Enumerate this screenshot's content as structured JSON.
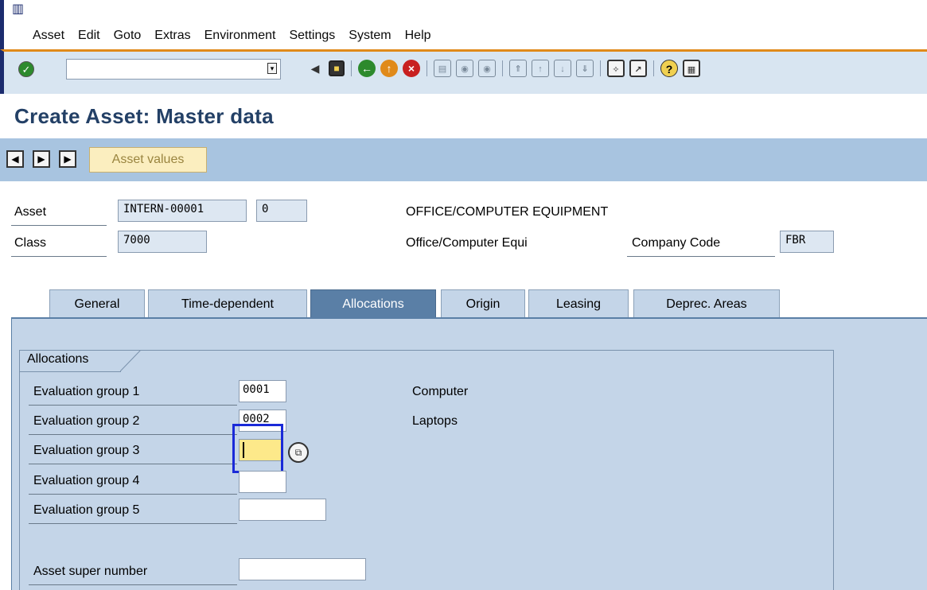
{
  "menubar": {
    "items": [
      {
        "label": "Asset"
      },
      {
        "label": "Edit"
      },
      {
        "label": "Goto"
      },
      {
        "label": "Extras"
      },
      {
        "label": "Environment"
      },
      {
        "label": "Settings"
      },
      {
        "label": "System"
      },
      {
        "label": "Help"
      }
    ]
  },
  "toolbar": {
    "command_value": "",
    "icons": [
      "enter-icon",
      "back-arrow-icon",
      "save-icon",
      "back-icon",
      "exit-icon",
      "cancel-icon",
      "print-icon",
      "find-icon",
      "find-next-icon",
      "first-page-icon",
      "previous-page-icon",
      "next-page-icon",
      "last-page-icon",
      "create-session-icon",
      "shortcut-icon",
      "help-icon",
      "layout-icon"
    ]
  },
  "page": {
    "title": "Create Asset: Master data"
  },
  "apptoolbar": {
    "asset_values_label": "Asset values"
  },
  "header": {
    "asset_label": "Asset",
    "asset_number": "INTERN-00001",
    "asset_subnumber": "0",
    "asset_description": "OFFICE/COMPUTER EQUIPMENT",
    "class_label": "Class",
    "class_value": "7000",
    "class_description": "Office/Computer Equi",
    "company_code_label": "Company Code",
    "company_code_value": "FBR"
  },
  "tabs": [
    {
      "label": "General"
    },
    {
      "label": "Time-dependent"
    },
    {
      "label": "Allocations"
    },
    {
      "label": "Origin"
    },
    {
      "label": "Leasing"
    },
    {
      "label": "Deprec. Areas"
    }
  ],
  "allocations": {
    "group_title": "Allocations",
    "rows": [
      {
        "label": "Evaluation group 1",
        "value": "0001",
        "description": "Computer"
      },
      {
        "label": "Evaluation group 2",
        "value": "0002",
        "description": "Laptops"
      },
      {
        "label": "Evaluation group 3",
        "value": "",
        "description": ""
      },
      {
        "label": "Evaluation group 4",
        "value": "",
        "description": ""
      },
      {
        "label": "Evaluation group 5",
        "value": "",
        "description": ""
      }
    ],
    "super_number_label": "Asset super number",
    "super_number_value": ""
  },
  "colors": {
    "accent": "#234066",
    "active_tab": "#5a7fa6",
    "toolbar_bg": "#d8e5f1",
    "focus_frame": "#1a2ad8"
  }
}
